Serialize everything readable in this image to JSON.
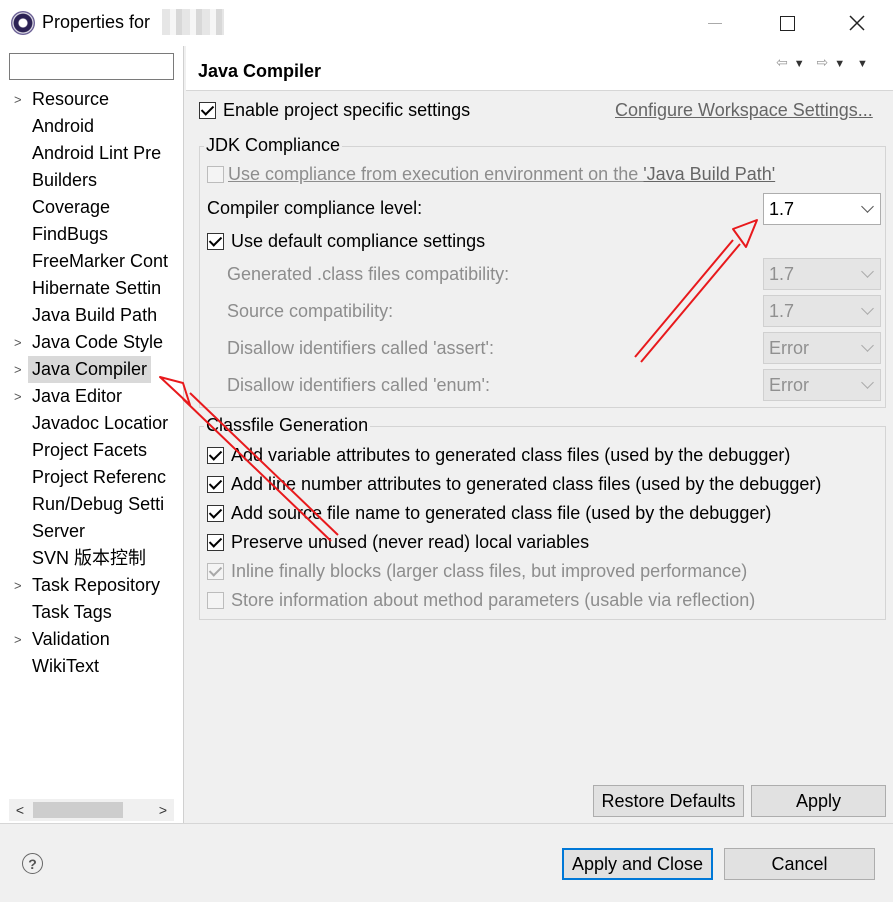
{
  "window": {
    "title": "Properties for",
    "minimize_label": "—",
    "close_label": "✕"
  },
  "left": {
    "filter_value": "",
    "tree": [
      {
        "label": "Resource",
        "expandable": true
      },
      {
        "label": "Android",
        "expandable": false
      },
      {
        "label": "Android Lint Pre",
        "expandable": false
      },
      {
        "label": "Builders",
        "expandable": false
      },
      {
        "label": "Coverage",
        "expandable": false
      },
      {
        "label": "FindBugs",
        "expandable": false
      },
      {
        "label": "FreeMarker Cont",
        "expandable": false
      },
      {
        "label": "Hibernate Settin",
        "expandable": false
      },
      {
        "label": "Java Build Path",
        "expandable": false
      },
      {
        "label": "Java Code Style",
        "expandable": true
      },
      {
        "label": "Java Compiler",
        "expandable": true,
        "selected": true
      },
      {
        "label": "Java Editor",
        "expandable": true
      },
      {
        "label": "Javadoc Locatior",
        "expandable": false
      },
      {
        "label": "Project Facets",
        "expandable": false
      },
      {
        "label": "Project Referenc",
        "expandable": false
      },
      {
        "label": "Run/Debug Setti",
        "expandable": false
      },
      {
        "label": "Server",
        "expandable": false
      },
      {
        "label": "SVN 版本控制",
        "expandable": false
      },
      {
        "label": "Task Repository",
        "expandable": true
      },
      {
        "label": "Task Tags",
        "expandable": false
      },
      {
        "label": "Validation",
        "expandable": true
      },
      {
        "label": "WikiText",
        "expandable": false
      }
    ],
    "scroll_left": "<",
    "scroll_right": ">"
  },
  "page": {
    "title": "Java Compiler",
    "nav_back": "⇦",
    "nav_forward": "⇨",
    "nav_dropdown": "▼",
    "nav_menu": "▼",
    "enable_project_specific": "Enable project specific settings",
    "configure_workspace_link": "Configure Workspace Settings...",
    "jdk": {
      "legend": "JDK Compliance",
      "use_env_compliance": "Use compliance from execution environment on the ",
      "java_build_path_link": "'Java Build Path'",
      "compliance_level_label": "Compiler compliance level:",
      "compliance_level_value": "1.7",
      "use_default": "Use default compliance settings",
      "generated_class_label": "Generated .class files compatibility:",
      "generated_class_value": "1.7",
      "source_compat_label": "Source compatibility:",
      "source_compat_value": "1.7",
      "assert_label": "Disallow identifiers called 'assert':",
      "assert_value": "Error",
      "enum_label": "Disallow identifiers called 'enum':",
      "enum_value": "Error"
    },
    "classfile": {
      "legend": "Classfile Generation",
      "var_attrs": "Add variable attributes to generated class files (used by the debugger)",
      "line_attrs": "Add line number attributes to generated class files (used by the debugger)",
      "source_name": "Add source file name to generated class file (used by the debugger)",
      "preserve_unused": "Preserve unused (never read) local variables",
      "inline_finally": "Inline finally blocks (larger class files, but improved performance)",
      "method_params": "Store information about method parameters (usable via reflection)"
    },
    "restore_defaults": "Restore Defaults",
    "apply": "Apply"
  },
  "footer": {
    "help": "?",
    "apply_close": "Apply and Close",
    "cancel": "Cancel"
  },
  "colors": {
    "annotation_arrow": "#e8191c",
    "default_button_border": "#0078d7"
  }
}
